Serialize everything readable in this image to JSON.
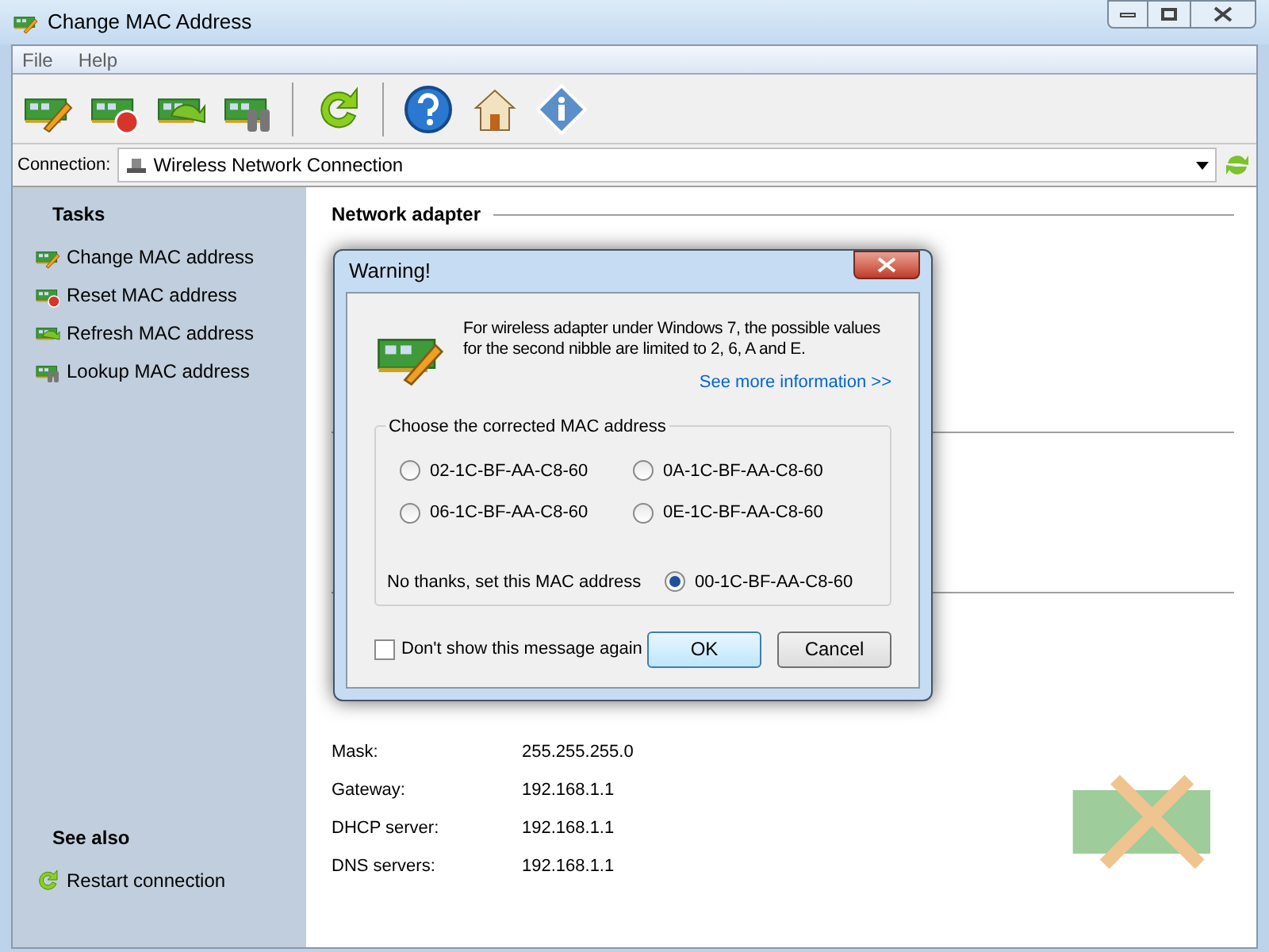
{
  "window": {
    "title": "Change MAC Address"
  },
  "menu": [
    "File",
    "Help"
  ],
  "toolbar": [
    {
      "kind": "change"
    },
    {
      "kind": "reset"
    },
    {
      "kind": "refresh"
    },
    {
      "kind": "lookup"
    },
    {
      "kind": "sep"
    },
    {
      "kind": "restart"
    },
    {
      "kind": "sep"
    },
    {
      "kind": "help"
    },
    {
      "kind": "home"
    },
    {
      "kind": "info"
    }
  ],
  "connection": {
    "label": "Connection:",
    "value": "Wireless Network Connection"
  },
  "sidebar": {
    "tasks_title": "Tasks",
    "tasks": [
      {
        "kind": "change",
        "label": "Change MAC address"
      },
      {
        "kind": "reset",
        "label": "Reset MAC address"
      },
      {
        "kind": "refresh",
        "label": "Refresh MAC address"
      },
      {
        "kind": "lookup",
        "label": "Lookup MAC address"
      }
    ],
    "see_also_title": "See also",
    "see_also": [
      {
        "kind": "restart",
        "label": "Restart connection"
      }
    ]
  },
  "content": {
    "section_title": "Network adapter",
    "rows": [
      {
        "label": "Mask:",
        "value": "255.255.255.0"
      },
      {
        "label": "Gateway:",
        "value": "192.168.1.1"
      },
      {
        "label": "DHCP server:",
        "value": "192.168.1.1"
      },
      {
        "label": "DNS servers:",
        "value": "192.168.1.1"
      }
    ]
  },
  "dialog": {
    "title": "Warning!",
    "message": "For wireless adapter under Windows 7, the possible values for the second nibble are limited to 2, 6, A and E.",
    "link": "See more information >>",
    "group_title": "Choose the corrected MAC address",
    "options": [
      {
        "label": "02-1C-BF-AA-C8-60",
        "selected": false
      },
      {
        "label": "0A-1C-BF-AA-C8-60",
        "selected": false
      },
      {
        "label": "06-1C-BF-AA-C8-60",
        "selected": false
      },
      {
        "label": "0E-1C-BF-AA-C8-60",
        "selected": false
      }
    ],
    "keep_label": "No thanks, set this MAC address",
    "keep_option": {
      "label": "00-1C-BF-AA-C8-60",
      "selected": true
    },
    "dont_show": {
      "label": "Don't show this message again",
      "checked": false
    },
    "buttons": [
      {
        "label": "OK",
        "kind": "default"
      },
      {
        "label": "Cancel",
        "kind": "normal"
      }
    ]
  }
}
